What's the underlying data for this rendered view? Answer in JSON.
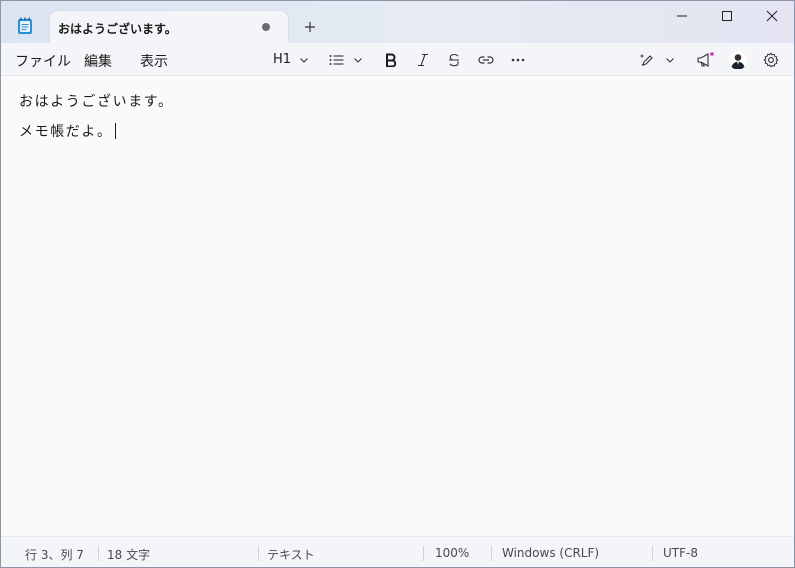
{
  "tab": {
    "title": "おはようございます。"
  },
  "menu": {
    "file": "ファイル",
    "edit": "編集",
    "view": "表示"
  },
  "toolbar": {
    "heading": "H1"
  },
  "document": {
    "lines": [
      "おはようございます。",
      "メモ帳だよ。"
    ]
  },
  "status": {
    "position": "行 3、列 7",
    "char_count": "18 文字",
    "format": "テキスト",
    "zoom": "100%",
    "line_ending": "Windows (CRLF)",
    "encoding": "UTF-8"
  },
  "colors": {
    "accent": "#0067c0",
    "notify_dot": "#c239b3"
  }
}
